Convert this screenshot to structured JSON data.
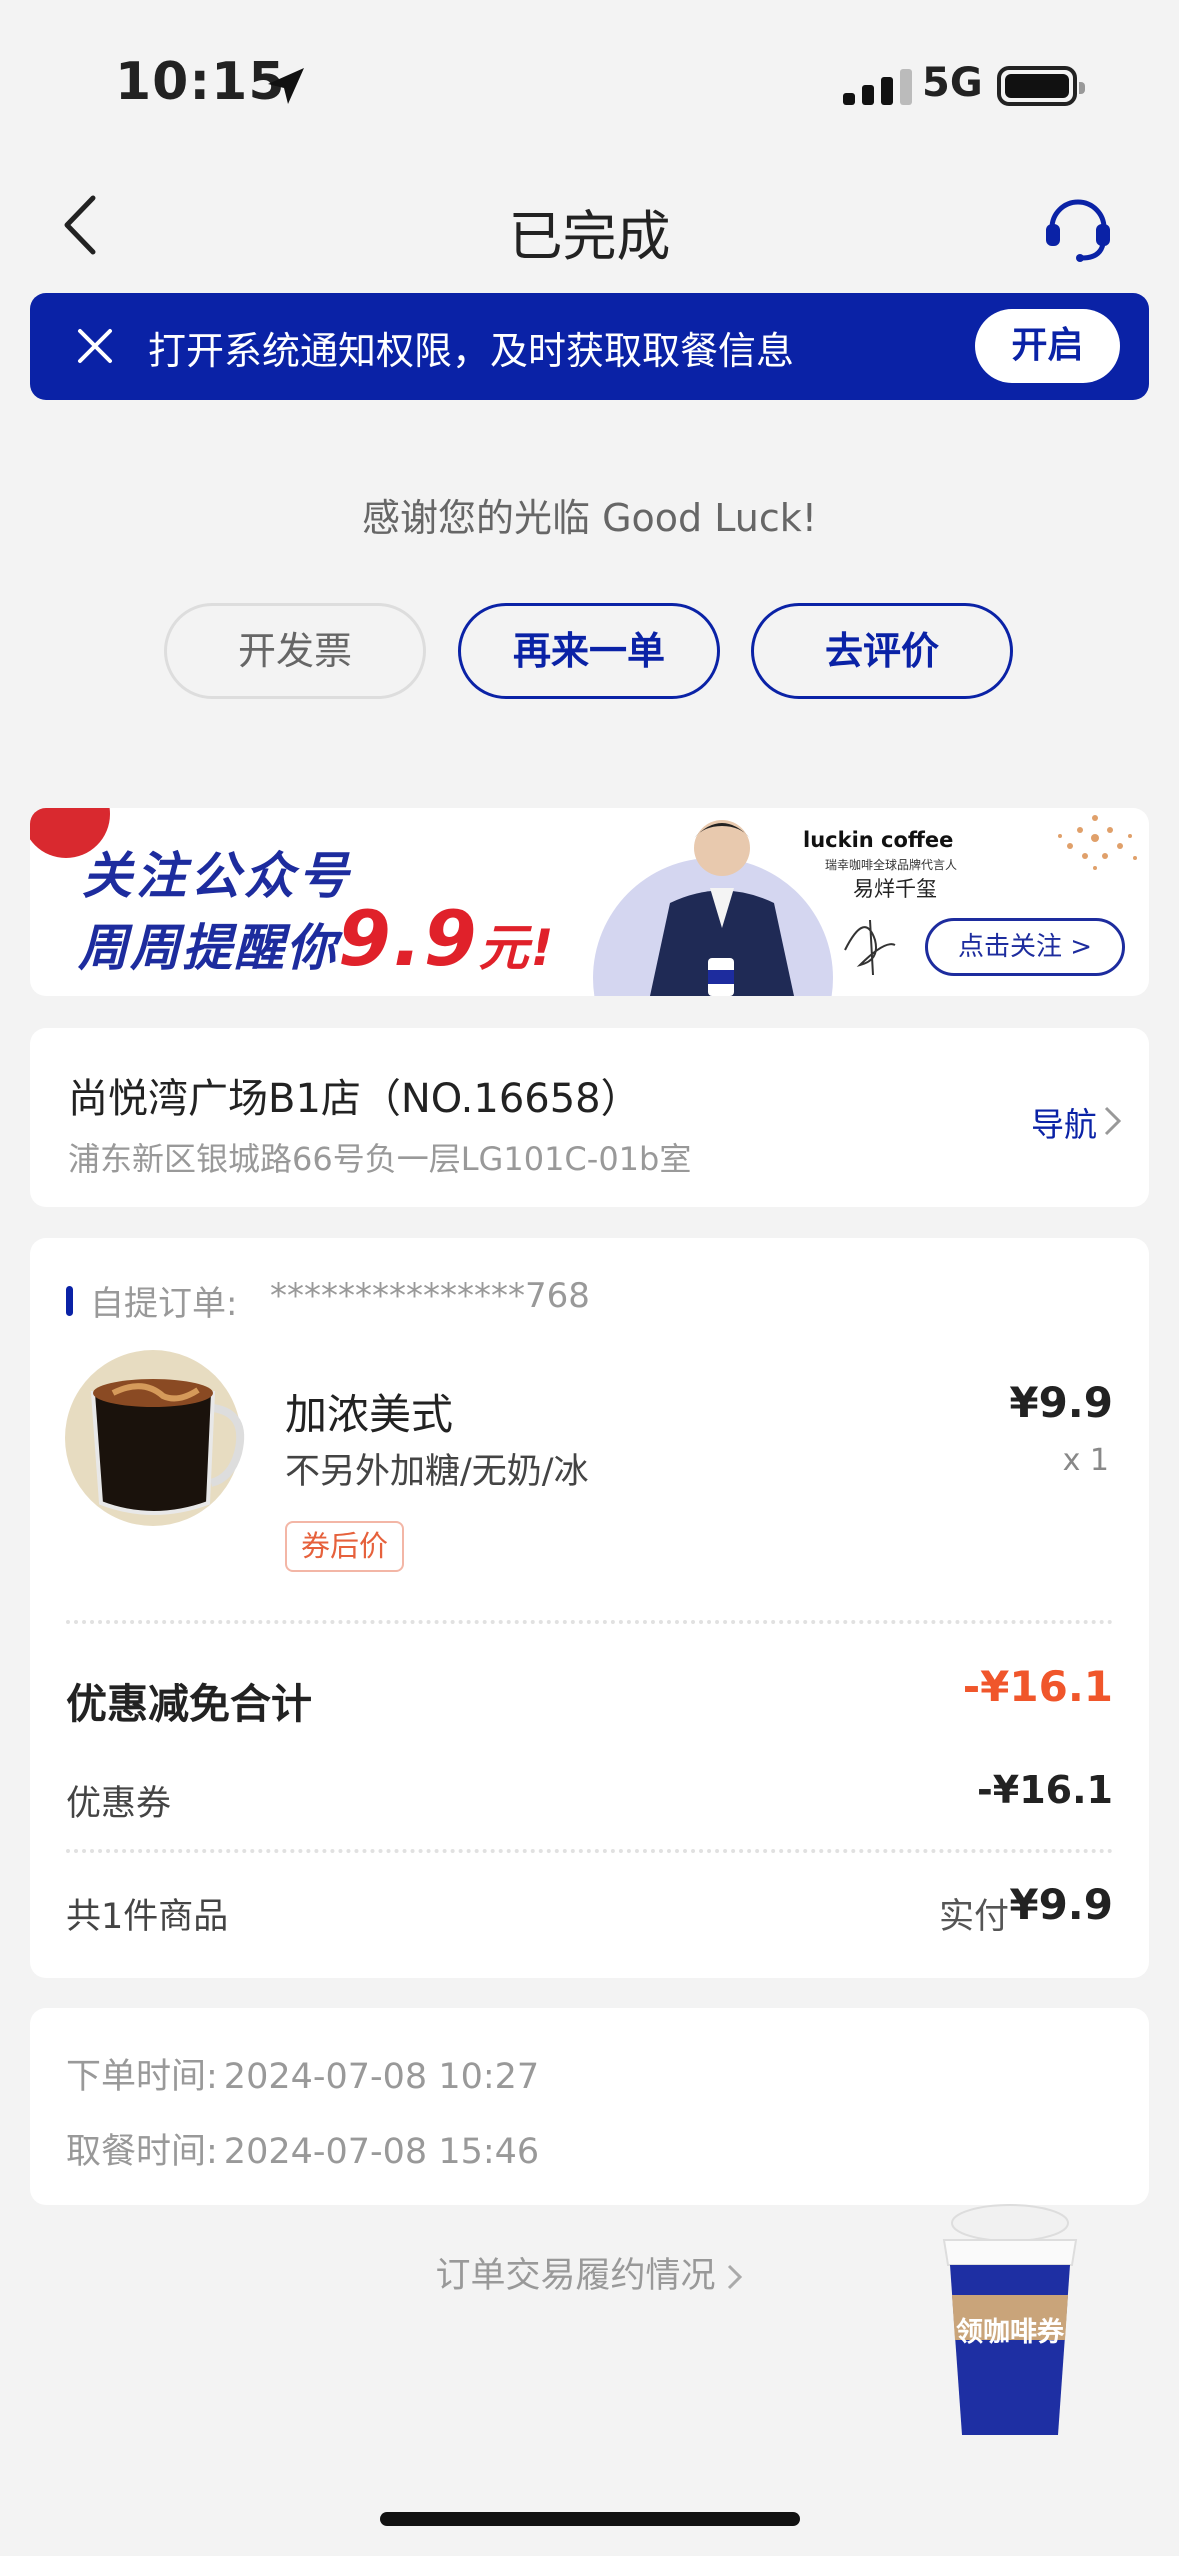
{
  "status_bar": {
    "time": "10:15",
    "network": "5G"
  },
  "header": {
    "title": "已完成"
  },
  "notice": {
    "text": "打开系统通知权限，及时获取取餐信息",
    "button": "开启"
  },
  "thanks": "感谢您的光临 Good Luck!",
  "actions": {
    "invoice": "开发票",
    "reorder": "再来一单",
    "review": "去评价"
  },
  "promo": {
    "line1": "关注公众号",
    "line2_prefix": "周周提醒你",
    "line2_price": "9.9",
    "line2_suffix": "元!",
    "brand": "luckin coffee",
    "brand_sub": "瑞幸咖啡全球品牌代言人",
    "ambassador": "易烊千玺",
    "follow_button": "点击关注 >"
  },
  "store": {
    "name": "尚悦湾广场B1店（NO.16658）",
    "address": "浦东新区银城路66号负一层LG101C-01b室",
    "nav_label": "导航"
  },
  "order": {
    "type_label": "自提订单:",
    "number": "***************768",
    "item": {
      "name": "加浓美式",
      "spec": "不另外加糖/无奶/冰",
      "tag": "券后价",
      "price": "¥9.9",
      "qty": "x 1"
    },
    "discount_label": "优惠减免合计",
    "discount_value": "-¥16.1",
    "coupon_label": "优惠券",
    "coupon_value": "-¥16.1",
    "count_label": "共1件商品",
    "paid_label": "实付",
    "paid_value": "¥9.9"
  },
  "times": {
    "order_label": "下单时间:",
    "order_time": "2024-07-08 10:27",
    "pickup_label": "取餐时间:",
    "pickup_time": "2024-07-08 15:46"
  },
  "trade_link": "订单交易履约情况",
  "floating_coupon": "领咖啡券",
  "colors": {
    "brand_blue": "#0a22a6",
    "discount_red": "#f0562b",
    "background": "#f3f3f3"
  }
}
